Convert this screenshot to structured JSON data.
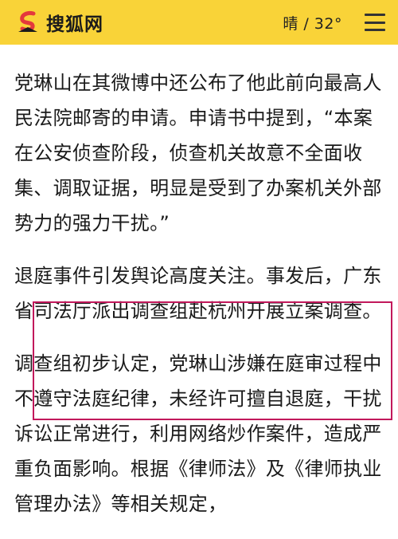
{
  "header": {
    "logo_text": "搜狐网",
    "weather": "晴 / 32°"
  },
  "colors": {
    "header_bg": "#f9d338",
    "logo_red": "#e4393c",
    "highlight": "#c2185b"
  },
  "icons": {
    "logo": "sohu-fox-logo-icon",
    "menu": "hamburger-menu-icon"
  },
  "article": {
    "paragraphs": [
      "党琳山在其微博中还公布了他此前向最高人民法院邮寄的申请。申请书中提到，“本案在公安侦查阶段，侦查机关故意不全面收集、调取证据，明显是受到了办案机关外部势力的强力干扰。”",
      "退庭事件引发舆论高度关注。事发后，广东省司法厅派出调查组赴杭州开展立案调查。",
      "调查组初步认定，党琳山涉嫌在庭审过程中不遵守法庭纪律，未经许可擅自退庭，干扰诉讼正常进行，利用网络炒作案件，造成严重负面影响。根据《律师法》及《律师执业管理办法》等相关规定，"
    ]
  }
}
